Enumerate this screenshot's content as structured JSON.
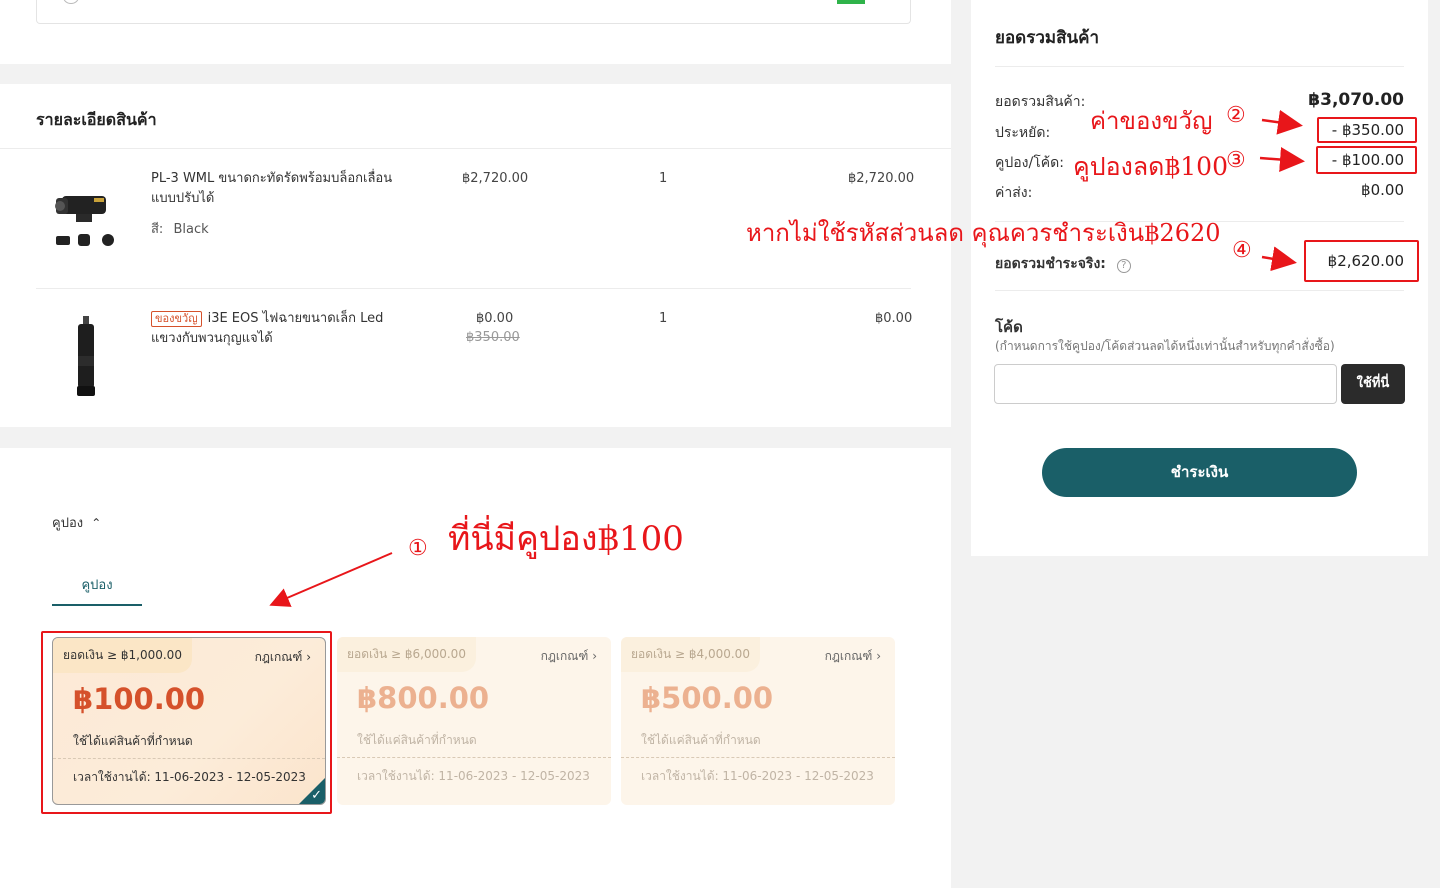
{
  "product_section": {
    "title": "รายละเอียดสินค้า",
    "items": [
      {
        "name": "PL-3 WML ขนาดกะทัดรัดพร้อมบล็อกเลื่อนแบบปรับได้",
        "attr_label": "สี:",
        "attr_value": "Black",
        "price": "฿2,720.00",
        "qty": "1",
        "subtotal": "฿2,720.00"
      },
      {
        "badge": "ของขวัญ",
        "name": "i3E EOS ไฟฉายขนาดเล็ก Led แขวงกับพวนกุญแจได้",
        "price": "฿0.00",
        "original_price": "฿350.00",
        "qty": "1",
        "subtotal": "฿0.00"
      }
    ]
  },
  "coupon_section": {
    "toggle_label": "คูปอง",
    "tab_label": "คูปอง",
    "cards": [
      {
        "min": "ยอดเงิน ≥ ฿1,000.00",
        "rules": "กฎเกณฑ์",
        "amount": "฿100.00",
        "desc": "ใช้ได้แค่สินค้าที่กำหนด",
        "valid": "เวลาใช้งานได้: 11-06-2023 - 12-05-2023",
        "selected": true
      },
      {
        "min": "ยอดเงิน ≥ ฿6,000.00",
        "rules": "กฎเกณฑ์",
        "amount": "฿800.00",
        "desc": "ใช้ได้แค่สินค้าที่กำหนด",
        "valid": "เวลาใช้งานได้: 11-06-2023 - 12-05-2023",
        "selected": false
      },
      {
        "min": "ยอดเงิน ≥ ฿4,000.00",
        "rules": "กฎเกณฑ์",
        "amount": "฿500.00",
        "desc": "ใช้ได้แค่สินค้าที่กำหนด",
        "valid": "เวลาใช้งานได้: 11-06-2023 - 12-05-2023",
        "selected": false
      }
    ]
  },
  "summary": {
    "title": "ยอดรวมสินค้า",
    "subtotal_label": "ยอดรวมสินค้า:",
    "subtotal_value": "฿3,070.00",
    "save_label": "ประหยัด:",
    "save_value": "- ฿350.00",
    "coupon_label": "คูปอง/โค้ด:",
    "coupon_value": "- ฿100.00",
    "shipping_label": "ค่าส่ง:",
    "shipping_value": "฿0.00",
    "total_label": "ยอดรวมชำระจริง:",
    "total_value": "฿2,620.00",
    "code_title": "โค้ด",
    "code_hint": "(กำหนดการใช้คูปอง/โค้ดส่วนลดได้หนึ่งเท่านั้นสำหรับทุกคำสั่งซื้อ)",
    "code_placeholder": "",
    "apply_button": "ใช้ที่นี่",
    "checkout_button": "ชำระเงิน"
  },
  "annotations": {
    "a1_num": "①",
    "a1_text": "ที่นี่มีคูปอง฿100",
    "a2_text": "ค่าของขวัญ",
    "a2_num": "②",
    "a3_text": "คูปองลด฿100",
    "a3_num": "③",
    "a4_text": "หากไม่ใช้รหัสส่วนลด คุณควรชำระเงิน฿2620",
    "a4_num": "④"
  },
  "colors": {
    "accent_teal": "#1a5f68",
    "coupon_red": "#d5512b",
    "annotation_red": "#e8161a"
  }
}
